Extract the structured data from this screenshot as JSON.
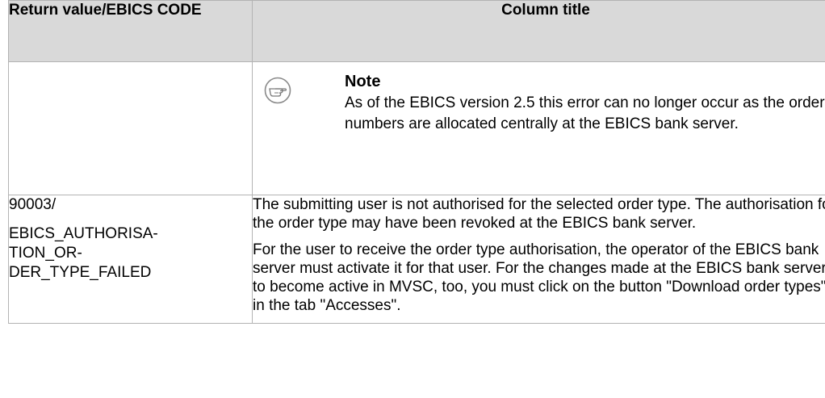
{
  "table": {
    "headers": {
      "col1": "Return value/EBICS CODE",
      "col2": "Column title"
    },
    "note_row": {
      "icon": "pointing-hand-icon",
      "title": "Note",
      "text": "As of the EBICS version 2.5 this error can no longer occur as the order numbers are allocated centrally at the EBICS bank server."
    },
    "error_row": {
      "code_number": "90003/",
      "code_name_lines": [
        "EBICS_AUTHORISA-",
        "TION_OR-",
        "DER_TYPE_FAILED"
      ],
      "description_paragraphs": [
        "The submitting user is not authorised for the selected order type. The authorisation for the order type may have been revoked at the EBICS bank server.",
        "For the user to receive the order type authorisation, the operator of the EBICS bank server must activate it for that user. For the changes made at the EBICS bank server to become active in MVSC, too, you must click on the button \"Download order types\" in the tab \"Accesses\"."
      ]
    }
  }
}
